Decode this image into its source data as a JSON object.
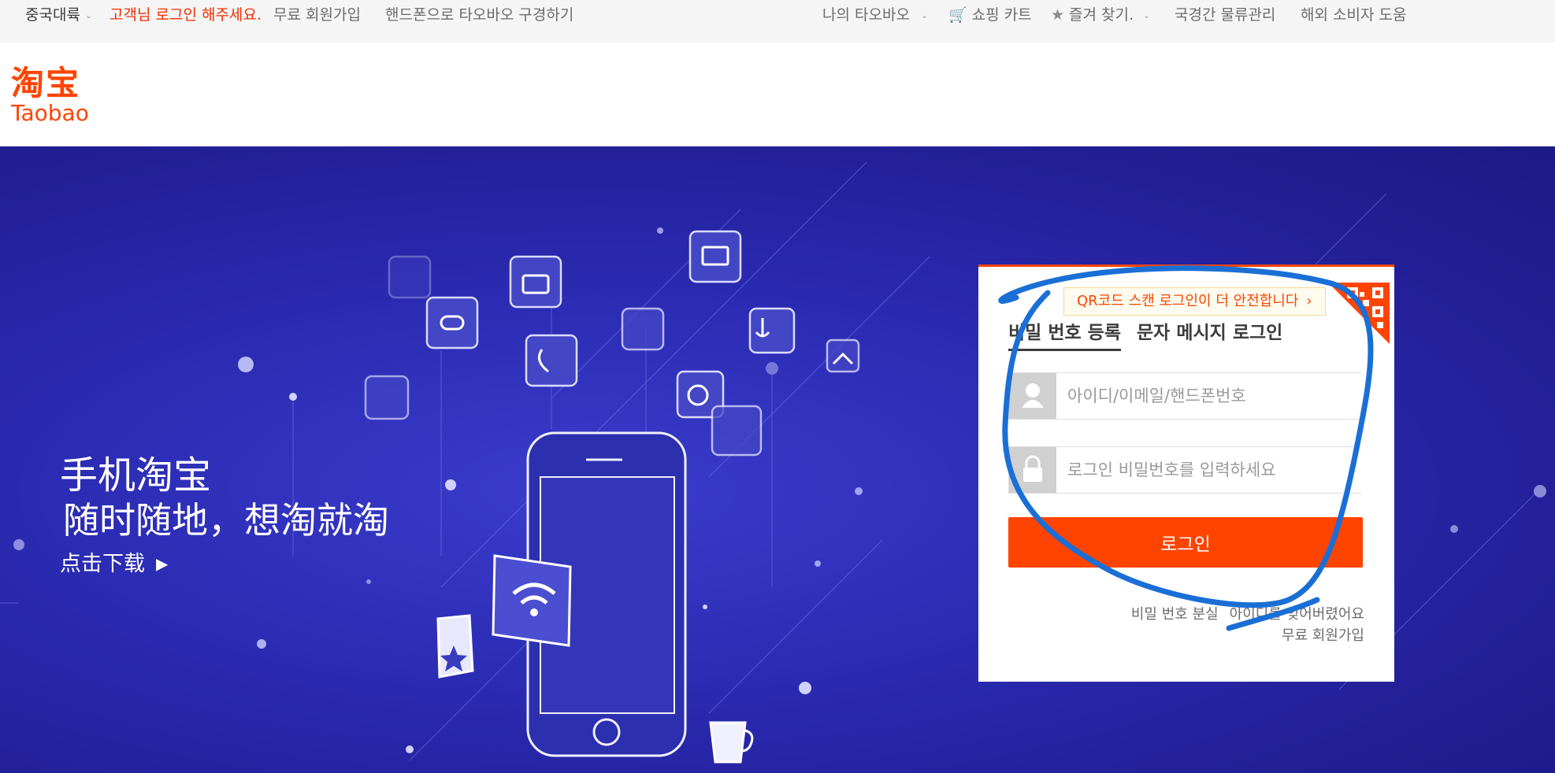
{
  "topbar": {
    "region": "중국대륙",
    "login_prompt": "고객님 로그인 해주세요.",
    "register": "무료 회원가입",
    "mobile_browse": "핸드폰으로 타오바오 구경하기",
    "my_taobao": "나의 타오바오",
    "cart": "쇼핑 카트",
    "favorites": "즐겨 찾기.",
    "logistics": "국경간 물류관리",
    "overseas_help": "해외 소비자 도움"
  },
  "logo": {
    "cn": "淘宝",
    "en": "Taobao"
  },
  "promo": {
    "line1": "手机淘宝",
    "line2": "随时随地，想淘就淘",
    "download": "点击下载"
  },
  "login": {
    "qr_tip": "QR코드 스캔 로그인이 더 안전합니다",
    "tab_password": "비밀 번호 등록",
    "tab_sms": "문자 메시지 로그인",
    "username_placeholder": "아이디/이메일/핸드폰번호",
    "password_placeholder": "로그인 비밀번호를 입력하세요",
    "submit": "로그인",
    "forgot_password": "비밀 번호 분실",
    "forgot_id": "아이디를 잊어버렸어요",
    "register": "무료 회원가입"
  },
  "colors": {
    "accent": "#ff4400",
    "banner": "#2b2bb3",
    "annotation": "#1a6fd6"
  }
}
